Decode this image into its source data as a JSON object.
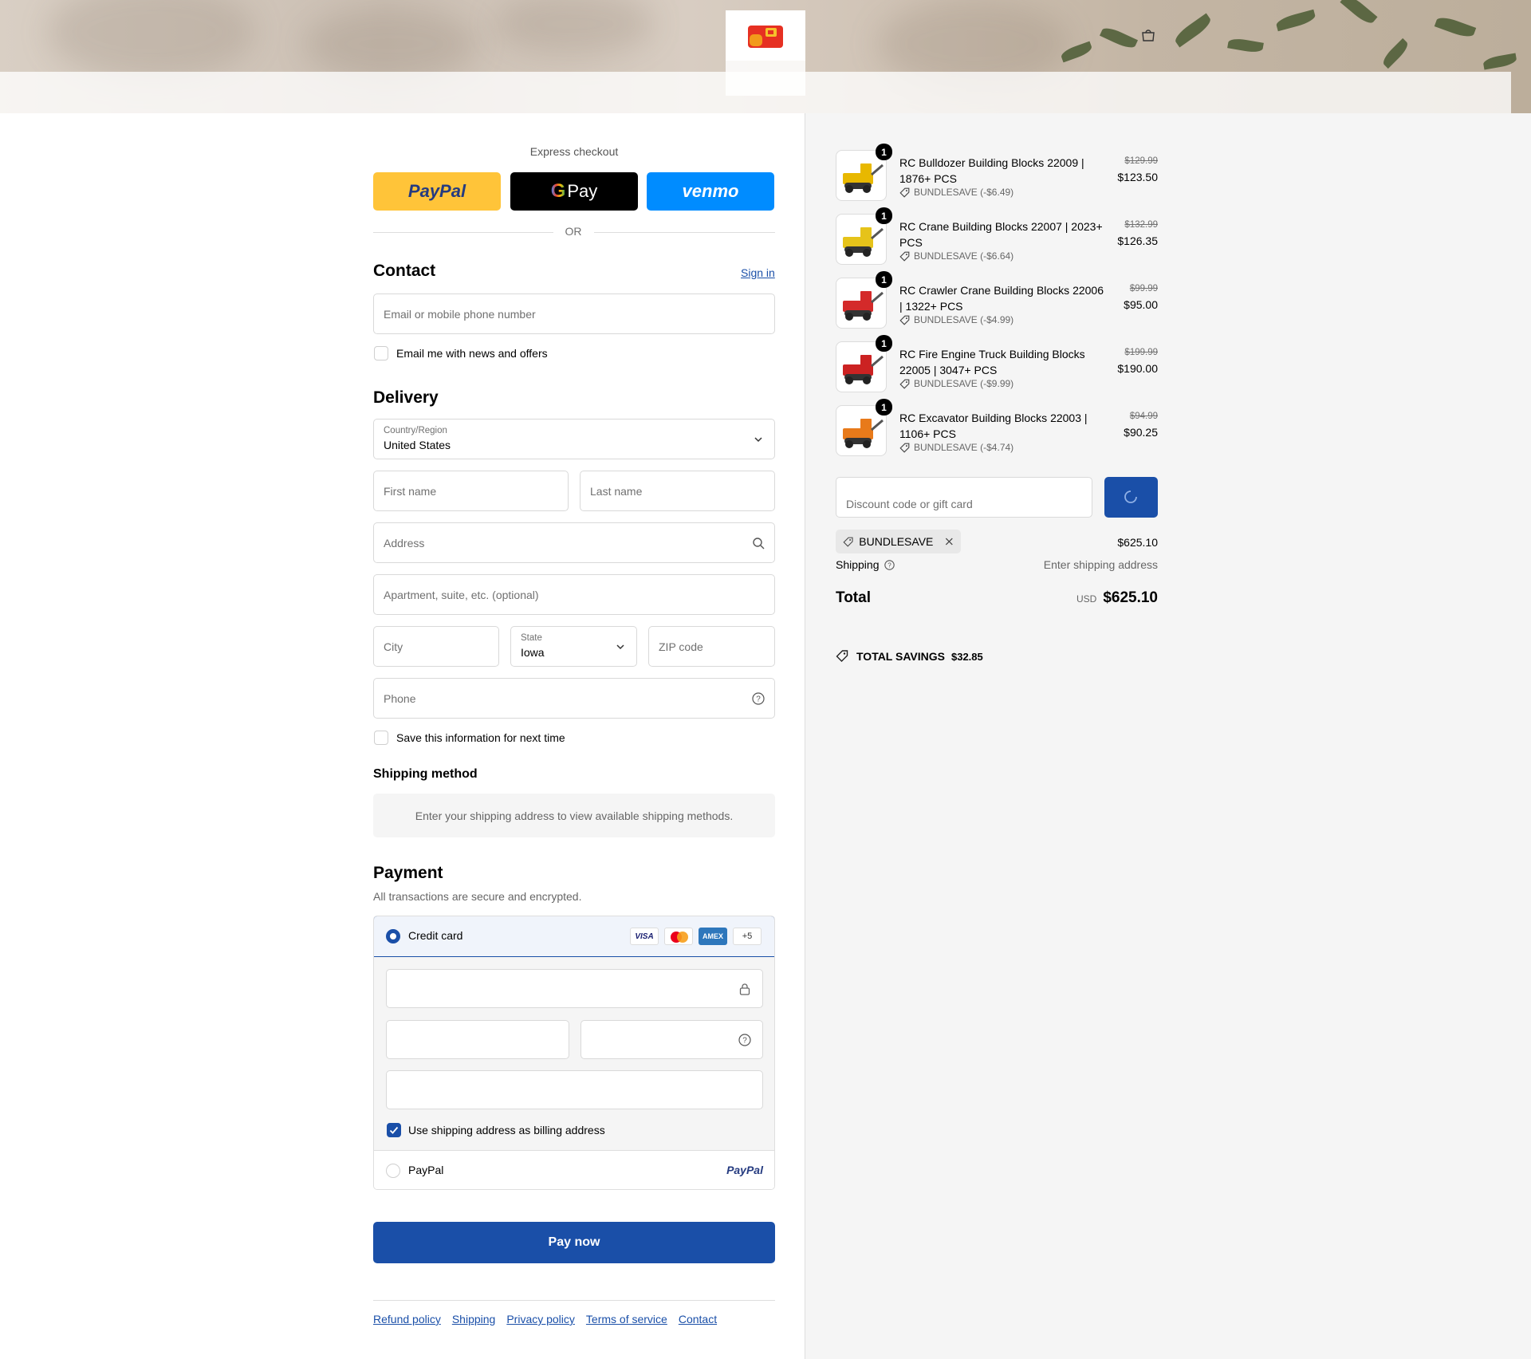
{
  "header": {
    "logo_icon": "store-logo",
    "cart_icon": "bag-icon"
  },
  "express": {
    "title": "Express checkout",
    "paypal": "PayPal",
    "gpay": "Pay",
    "venmo": "venmo",
    "or": "OR"
  },
  "contact": {
    "heading": "Contact",
    "sign_in": "Sign in",
    "email_placeholder": "Email or mobile phone number",
    "news_label": "Email me with news and offers"
  },
  "delivery": {
    "heading": "Delivery",
    "country_label": "Country/Region",
    "country_value": "United States",
    "first_name": "First name",
    "last_name": "Last name",
    "address": "Address",
    "apartment": "Apartment, suite, etc. (optional)",
    "city": "City",
    "state_label": "State",
    "state_value": "Iowa",
    "zip": "ZIP code",
    "phone": "Phone",
    "save_label": "Save this information for next time"
  },
  "shipping_method": {
    "heading": "Shipping method",
    "notice": "Enter your shipping address to view available shipping methods."
  },
  "payment": {
    "heading": "Payment",
    "subtitle": "All transactions are secure and encrypted.",
    "credit_card": "Credit card",
    "card_brands": [
      "VISA",
      "",
      "AMEX",
      "+5"
    ],
    "billing_label": "Use shipping address as billing address",
    "paypal": "PayPal",
    "paypal_logo": "PayPal",
    "pay_now": "Pay now"
  },
  "footer": {
    "links": [
      "Refund policy",
      "Shipping",
      "Privacy policy",
      "Terms of service",
      "Contact"
    ]
  },
  "order": {
    "items": [
      {
        "qty": "1",
        "name": "RC Bulldozer Building Blocks 22009 | 1876+ PCS",
        "discount": "BUNDLESAVE (-$6.49)",
        "old_price": "$129.99",
        "price": "$123.50",
        "color": "#e8b800"
      },
      {
        "qty": "1",
        "name": "RC Crane Building Blocks 22007 | 2023+ PCS",
        "discount": "BUNDLESAVE (-$6.64)",
        "old_price": "$132.99",
        "price": "$126.35",
        "color": "#e6c31a"
      },
      {
        "qty": "1",
        "name": "RC Crawler Crane Building Blocks 22006 | 1322+ PCS",
        "discount": "BUNDLESAVE (-$4.99)",
        "old_price": "$99.99",
        "price": "$95.00",
        "color": "#d42a2a"
      },
      {
        "qty": "1",
        "name": "RC Fire Engine Truck Building Blocks 22005 | 3047+ PCS",
        "discount": "BUNDLESAVE (-$9.99)",
        "old_price": "$199.99",
        "price": "$190.00",
        "color": "#cc2222"
      },
      {
        "qty": "1",
        "name": "RC Excavator Building Blocks 22003 | 1106+ PCS",
        "discount": "BUNDLESAVE (-$4.74)",
        "old_price": "$94.99",
        "price": "$90.25",
        "color": "#e87a1a"
      }
    ],
    "discount_placeholder": "Discount code or gift card",
    "code_chip": "BUNDLESAVE",
    "subtotal": "$625.10",
    "shipping_label": "Shipping",
    "shipping_value": "Enter shipping address",
    "total_label": "Total",
    "currency": "USD",
    "total": "$625.10",
    "savings_label": "TOTAL SAVINGS",
    "savings_value": "$32.85"
  },
  "colors": {
    "accent": "#1a4fa8",
    "paypal_yellow": "#ffc439",
    "venmo_blue": "#008cff"
  }
}
